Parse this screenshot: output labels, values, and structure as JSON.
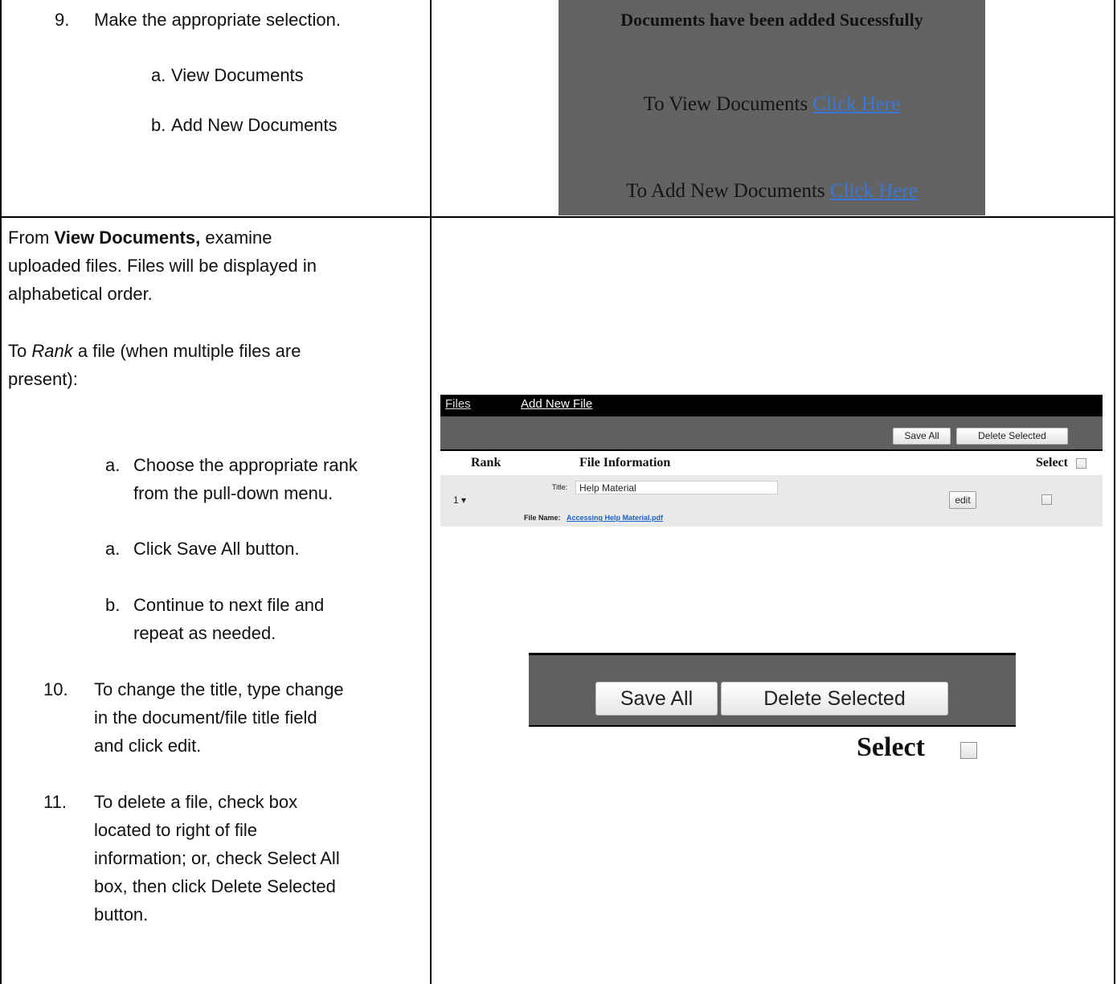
{
  "row1": {
    "step_number": "9.",
    "step_text": "Make the appropriate selection.",
    "sub_items": [
      {
        "marker": "a.",
        "text": "View Documents"
      },
      {
        "marker": "b.",
        "text": "Add New Documents"
      }
    ],
    "screenshot": {
      "headline": "Documents have been added Sucessfully",
      "view_prefix": "To View Documents",
      "view_link": "Click Here",
      "add_prefix": "To Add New Documents",
      "add_link": "Click Here"
    }
  },
  "row2": {
    "intro_prefix": "From",
    "intro_bold": "View Documents,",
    "intro_rest_1": "examine",
    "intro_line_2": "uploaded files. Files will be displayed in",
    "intro_line_3": "alphabetical order.",
    "rank_prefix": "To",
    "rank_italic": "Rank",
    "rank_rest": "a file (when multiple files are",
    "rank_line_2": "present):",
    "sub_items": [
      {
        "marker": "a.",
        "line1": "Choose the appropriate rank",
        "line2": "from the pull-down menu."
      },
      {
        "marker": "a.",
        "line1": "Click Save All button.",
        "line2": ""
      },
      {
        "marker": "b.",
        "line1": "Continue to next file and",
        "line2": "repeat as needed."
      }
    ],
    "steps": [
      {
        "number": "10.",
        "lines": [
          "To change the title, type change",
          "in the document/file title field",
          "and click edit."
        ]
      },
      {
        "number": "11.",
        "lines": [
          "To delete a file, check box",
          "located to right of file",
          "information; or, check Select All",
          "box, then click Delete Selected",
          "button."
        ]
      }
    ],
    "files_ui": {
      "tab_files": "Files",
      "tab_add": "Add New File",
      "save_all": "Save All",
      "delete_selected": "Delete Selected",
      "col_rank": "Rank",
      "col_file_info": "File Information",
      "col_select": "Select",
      "row": {
        "rank": "1 ▾",
        "title_label": "Title:",
        "title_value": "Help Material",
        "file_name_label": "File Name:",
        "file_name": "Accessing Help Material.pdf",
        "edit": "edit"
      }
    },
    "zoom_ui": {
      "save_all": "Save All",
      "delete_selected": "Delete Selected",
      "select_label": "Select"
    }
  }
}
